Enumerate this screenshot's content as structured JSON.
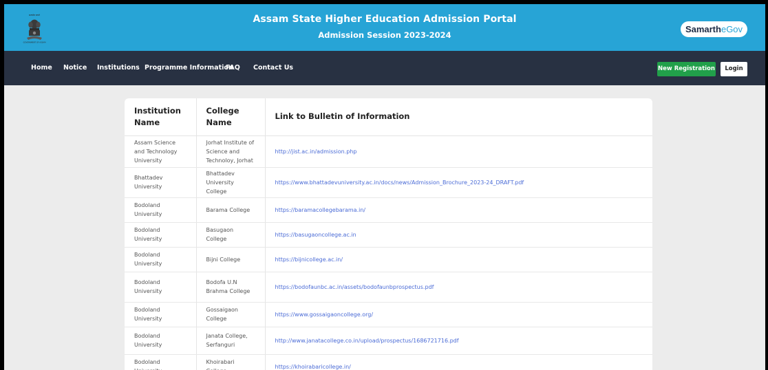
{
  "header": {
    "title": "Assam State Higher Education Admission Portal",
    "subtitle": "Admission Session 2023-2024",
    "emblem_caption_top": "सत्यमेव जयते",
    "emblem_caption_bottom": "GOVERNMENT OF ASSAM",
    "brand": {
      "part1": "Samarth",
      "part2": "eGov"
    },
    "colors": {
      "header_bg": "#27a4d6",
      "nav_bg": "#283142",
      "register_bg": "#21a04a",
      "link": "#4a6bd6"
    }
  },
  "nav": {
    "items": [
      {
        "label": "Home"
      },
      {
        "label": "Notice"
      },
      {
        "label": "Institutions"
      },
      {
        "label": "Programme Information"
      },
      {
        "label": "FAQ"
      },
      {
        "label": "Contact Us"
      }
    ],
    "register_label": "New Registration",
    "login_label": "Login"
  },
  "table": {
    "headers": [
      "Institution Name",
      "College Name",
      "Link to Bulletin of Information"
    ],
    "rows": [
      {
        "institution": "Assam Science and Technology University",
        "college": "Jorhat Institute of Science and Technoloy, Jorhat",
        "link": "http://jist.ac.in/admission.php"
      },
      {
        "institution": "Bhattadev University",
        "college": "Bhattadev University College",
        "link": "https://www.bhattadevuniversity.ac.in/docs/news/Admission_Brochure_2023-24_DRAFT.pdf"
      },
      {
        "institution": "Bodoland University",
        "college": "Barama College",
        "link": "https://baramacollegebarama.in/"
      },
      {
        "institution": "Bodoland University",
        "college": "Basugaon College",
        "link": "https://basugaoncollege.ac.in"
      },
      {
        "institution": "Bodoland University",
        "college": "Bijni College",
        "link": "https://bijnicollege.ac.in/"
      },
      {
        "institution": "Bodoland University",
        "college": "Bodofa U.N Brahma College",
        "link": "https://bodofaunbc.ac.in/assets/bodofaunbprospectus.pdf"
      },
      {
        "institution": "Bodoland University",
        "college": "Gossaigaon College",
        "link": "https://www.gossaigaoncollege.org/"
      },
      {
        "institution": "Bodoland University",
        "college": "Janata College, Serfanguri",
        "link": "http://www.janatacollege.co.in/upload/prospectus/1686721716.pdf"
      },
      {
        "institution": "Bodoland University",
        "college": "Khoirabari College",
        "link": "https://khoirabaricollege.in/"
      }
    ]
  }
}
